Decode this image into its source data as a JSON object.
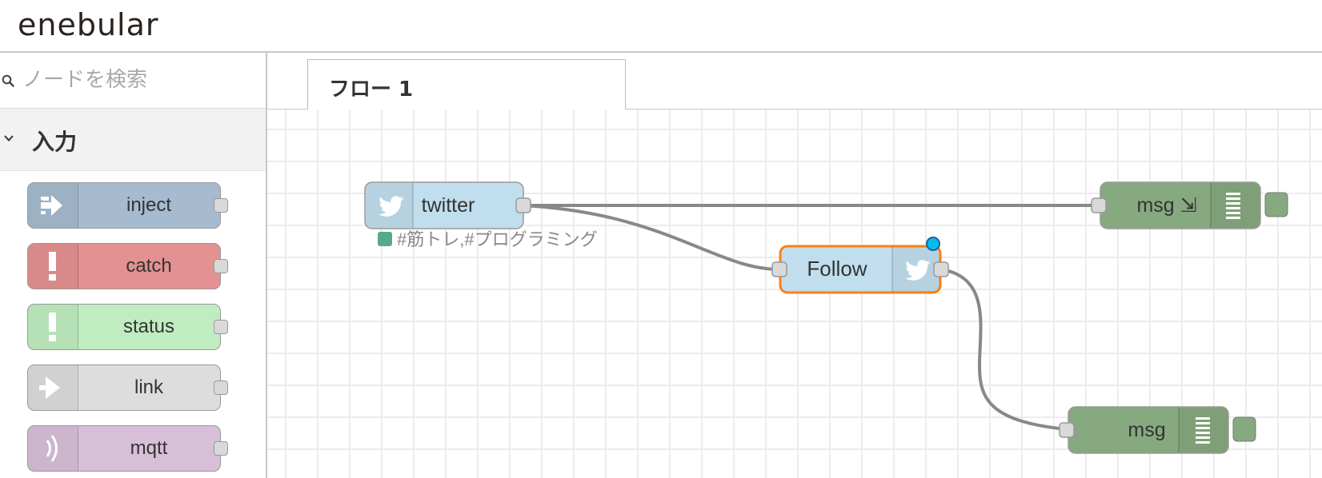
{
  "header": {
    "logo": "enebular"
  },
  "sidebar": {
    "search_placeholder": "ノードを検索",
    "category_label": "入力",
    "nodes": [
      {
        "label": "inject",
        "color": "#a6bbcf"
      },
      {
        "label": "catch",
        "color": "#e49191"
      },
      {
        "label": "status",
        "color": "#c0edc0"
      },
      {
        "label": "link",
        "color": "#dddddd"
      },
      {
        "label": "mqtt",
        "color": "#d8bfd8"
      }
    ]
  },
  "workspace": {
    "tab_label": "フロー 1",
    "nodes": {
      "twitter_in": {
        "label": "twitter",
        "status": "#筋トレ,#プログラミング",
        "color": "#c0deed"
      },
      "follow": {
        "label": "Follow",
        "color": "#c0deed",
        "selected_color": "#ff7f0e"
      },
      "debug1": {
        "label": "msg ⇲",
        "color": "#87a980"
      },
      "debug2": {
        "label": "msg",
        "color": "#87a980"
      }
    },
    "status_color": "#5a8",
    "wire_color": "#888888"
  },
  "icons": [
    "search-icon",
    "chevron-down-icon",
    "inject-icon",
    "catch-icon",
    "status-icon",
    "link-icon",
    "mqtt-icon",
    "twitter-icon",
    "debug-icon"
  ]
}
